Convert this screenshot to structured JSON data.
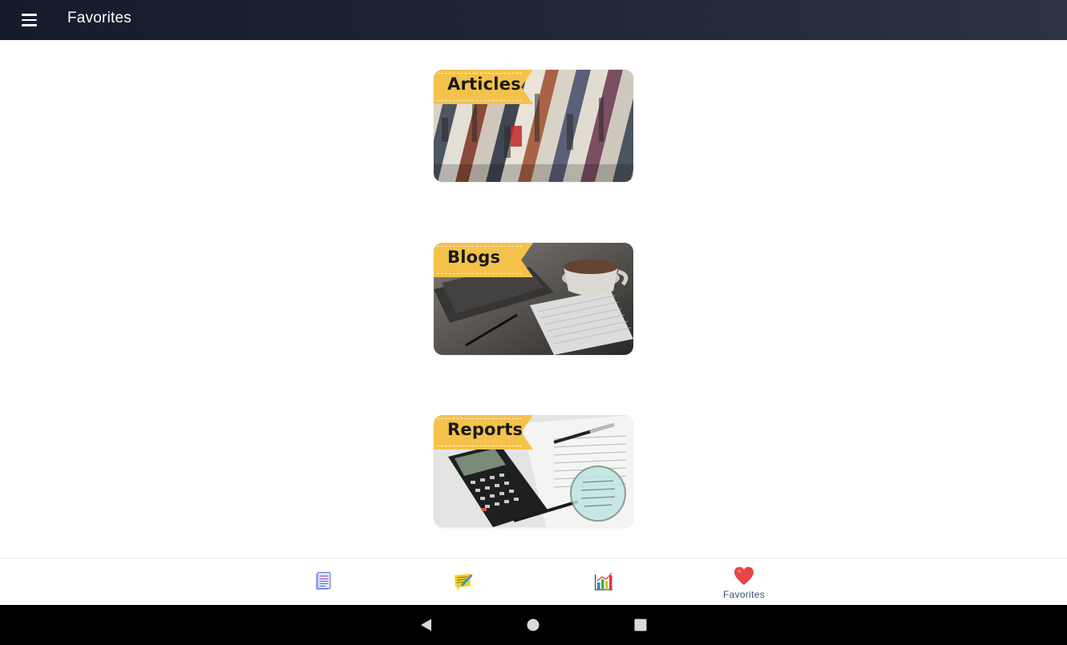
{
  "appbar": {
    "title": "Favorites",
    "menu_icon": "hamburger-menu-icon",
    "background": "#1d2535"
  },
  "cards": [
    {
      "label": "Articles",
      "image": "rolled-newspapers-photo"
    },
    {
      "label": "Blogs",
      "image": "notebook-coffee-pen-photo"
    },
    {
      "label": "Reports",
      "image": "calculator-magnifier-photo"
    }
  ],
  "banner_color": "#f4c24b",
  "bottom_nav": {
    "items": [
      {
        "icon": "document-icon",
        "label": ""
      },
      {
        "icon": "notes-pencil-icon",
        "label": ""
      },
      {
        "icon": "bar-chart-icon",
        "label": ""
      },
      {
        "icon": "heart-icon",
        "label": "Favorites",
        "active": true
      }
    ],
    "active_color": "#3b4a7a"
  },
  "system_nav": {
    "buttons": [
      "back-icon",
      "home-icon",
      "recents-icon"
    ]
  }
}
